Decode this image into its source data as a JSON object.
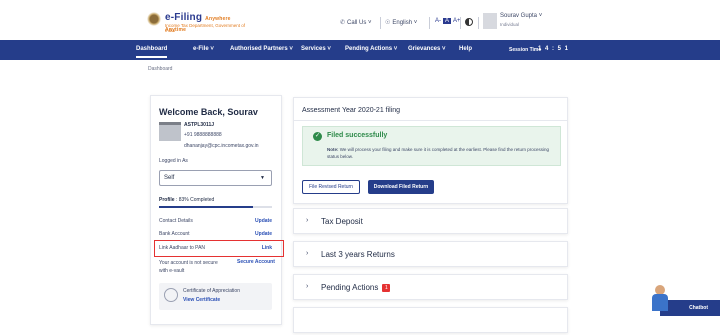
{
  "header": {
    "brand": "e-Filing",
    "brand_suffix": "Anywhere Anytime",
    "tagline": "Income Tax Department, Government of India",
    "call_us": "Call Us",
    "language": "English",
    "text_size": {
      "small": "A-",
      "normal": "A",
      "large": "A+"
    },
    "user_name": "Sourav Gupta",
    "user_role": "Individual"
  },
  "nav": {
    "items": [
      "Dashboard",
      "e-File",
      "Authorised Partners",
      "Services",
      "Pending Actions",
      "Grievances",
      "Help"
    ],
    "session_label": "Session Time",
    "session_time": "1 4 : 5 1"
  },
  "breadcrumb": "Dashboard",
  "profile_card": {
    "welcome": "Welcome Back, Sourav",
    "pan": "ASTPL3011J",
    "phone": "+91 9888888888",
    "email": "dhananjay@cpc.incometax.gov.in",
    "logged_in_as_label": "Logged in As",
    "logged_in_as_value": "Self",
    "profile_label": "Profile",
    "profile_completion": "83% Completed",
    "profile_percent": 83,
    "rows": [
      {
        "label": "Contact Details",
        "action": "Update"
      },
      {
        "label": "Bank Account",
        "action": "Update"
      },
      {
        "label": "Link Aadhaar to PAN",
        "action": "Link"
      }
    ],
    "vault_text": "Your account is not secure with e-vault",
    "vault_action": "Secure Account",
    "certificate_title": "Certificate of Appreciation",
    "certificate_link": "View Certificate"
  },
  "main": {
    "assessment_title": "Assessment Year 2020-21 filing",
    "success_heading": "Filed successfully",
    "note_label": "Note:",
    "note_text": "We will process your filing and make sure it is completed at the earliest. Please find the return processing status below.",
    "revised_button": "File Revised Return",
    "download_button": "Download Filed Return",
    "accordions": [
      {
        "label": "Tax Deposit",
        "badge": ""
      },
      {
        "label": "Last 3 years Returns",
        "badge": ""
      },
      {
        "label": "Pending Actions",
        "badge": "1"
      }
    ]
  },
  "chatbot": "Chatbot"
}
